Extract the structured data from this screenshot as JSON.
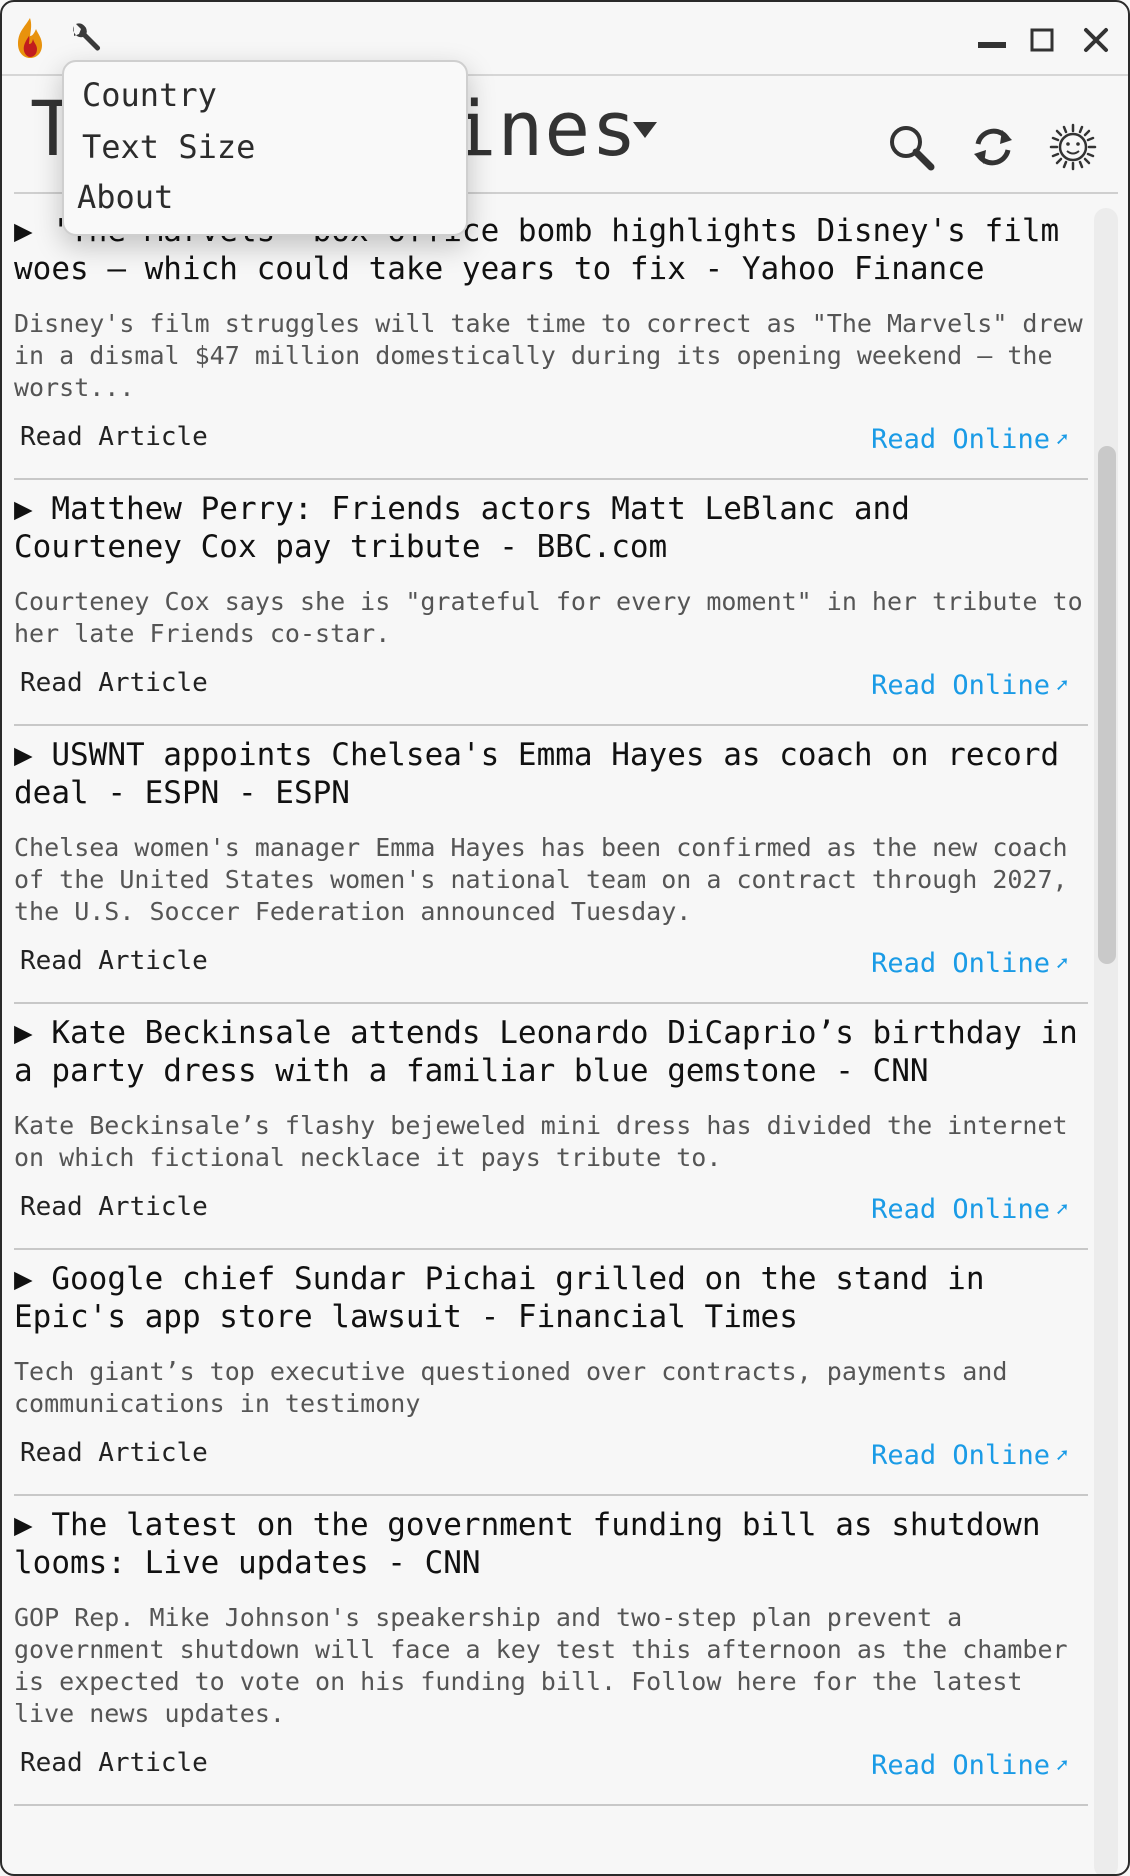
{
  "window": {
    "controls": [
      "minimize",
      "maximize",
      "close"
    ]
  },
  "header": {
    "title": "Top Headlines",
    "icons": [
      "search-icon",
      "refresh-icon",
      "theme-sun-icon"
    ]
  },
  "menu": {
    "items": [
      "Country",
      "Text Size",
      "About"
    ]
  },
  "articles": [
    {
      "title": "▶ 'The Marvels' box office bomb highlights Disney's film woes — which could take years to fix - Yahoo Finance",
      "description": "Disney's film struggles will take time to correct as \"The Marvels\" drew in a dismal $47 million domestically during its opening weekend — the worst...",
      "read_article": "Read Article",
      "read_online": "Read Online"
    },
    {
      "title": "▶ Matthew Perry: Friends actors Matt LeBlanc and Courteney Cox pay tribute - BBC.com",
      "description": "Courteney Cox says she is \"grateful for every moment\" in her tribute to her late Friends co-star.",
      "read_article": "Read Article",
      "read_online": "Read Online"
    },
    {
      "title": "▶ USWNT appoints Chelsea's Emma Hayes as coach on record deal - ESPN - ESPN",
      "description": "Chelsea women's manager Emma Hayes has been confirmed as the new coach of the United States women's national team on a contract through 2027, the U.S. Soccer Federation announced Tuesday.",
      "read_article": "Read Article",
      "read_online": "Read Online"
    },
    {
      "title": "▶ Kate Beckinsale attends Leonardo DiCaprio’s birthday in a party dress with a familiar blue gemstone - CNN",
      "description": "Kate Beckinsale’s flashy bejeweled mini dress has divided the internet on which fictional necklace it pays tribute to.",
      "read_article": "Read Article",
      "read_online": "Read Online"
    },
    {
      "title": "▶ Google chief Sundar Pichai grilled on the stand in Epic's app store lawsuit - Financial Times",
      "description": "Tech giant’s top executive questioned over contracts, payments and communications in testimony",
      "read_article": "Read Article",
      "read_online": "Read Online"
    },
    {
      "title": "▶ The latest on the government funding bill as shutdown looms: Live updates - CNN",
      "description": "GOP Rep. Mike Johnson's speakership and two-step plan prevent a government shutdown will face a key test this afternoon as the chamber is expected to vote on his funding bill. Follow here for the latest live news updates.",
      "read_article": "Read Article",
      "read_online": "Read Online"
    }
  ],
  "colors": {
    "link": "#1a9be6",
    "background": "#f7f7f7",
    "divider": "#c8c8c8"
  }
}
